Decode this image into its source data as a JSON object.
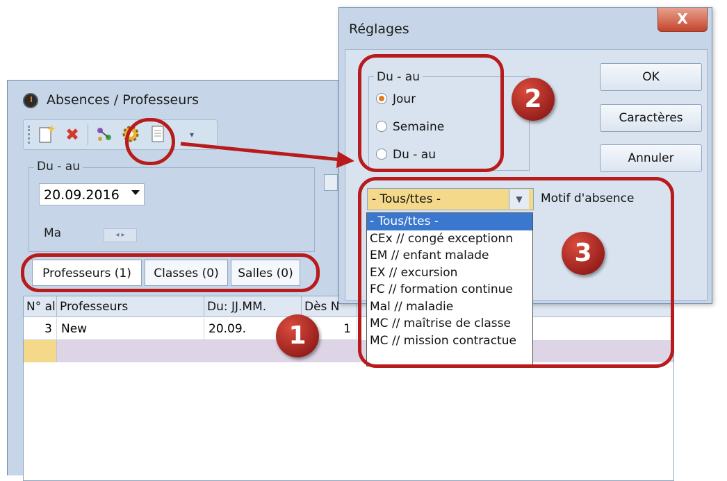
{
  "back_window": {
    "title": "Absences / Professeurs",
    "toolbar_icons": [
      "new-icon",
      "delete-icon",
      "link-icon",
      "settings-icon",
      "print-icon"
    ],
    "duau_legend": "Du - au",
    "date_value": "20.09.2016",
    "ma_label": "Ma",
    "tabs": [
      {
        "label": "Professeurs (1)"
      },
      {
        "label": "Classes (0)"
      },
      {
        "label": "Salles (0)"
      }
    ],
    "columns": [
      "N° al",
      "Professeurs",
      "Du: JJ.MM.",
      "Dès N"
    ],
    "rows": [
      {
        "num": "3",
        "prof": "New",
        "du": "20.09.",
        "des": "1"
      }
    ]
  },
  "dialog": {
    "title": "Réglages",
    "close_label": "X",
    "radio_legend": "Du - au",
    "radios": [
      {
        "label": "Jour",
        "selected": true
      },
      {
        "label": "Semaine",
        "selected": false
      },
      {
        "label": "Du - au",
        "selected": false
      }
    ],
    "buttons": {
      "ok": "OK",
      "chars": "Caractères",
      "cancel": "Annuler"
    },
    "motif_value": "- Tous/ttes -",
    "motif_label": "Motif d'absence",
    "options": [
      "- Tous/ttes -",
      "CEx // congé exceptionn",
      "EM // enfant malade",
      "EX // excursion",
      "FC // formation continue",
      "Mal // maladie",
      "MC // maîtrise de classe",
      "MC // mission contractue"
    ]
  },
  "annotations": [
    "1",
    "2",
    "3"
  ],
  "colors": {
    "annotation": "#b81b1b",
    "window_bg": "#c6d6e8",
    "selection": "#3a78d0"
  }
}
